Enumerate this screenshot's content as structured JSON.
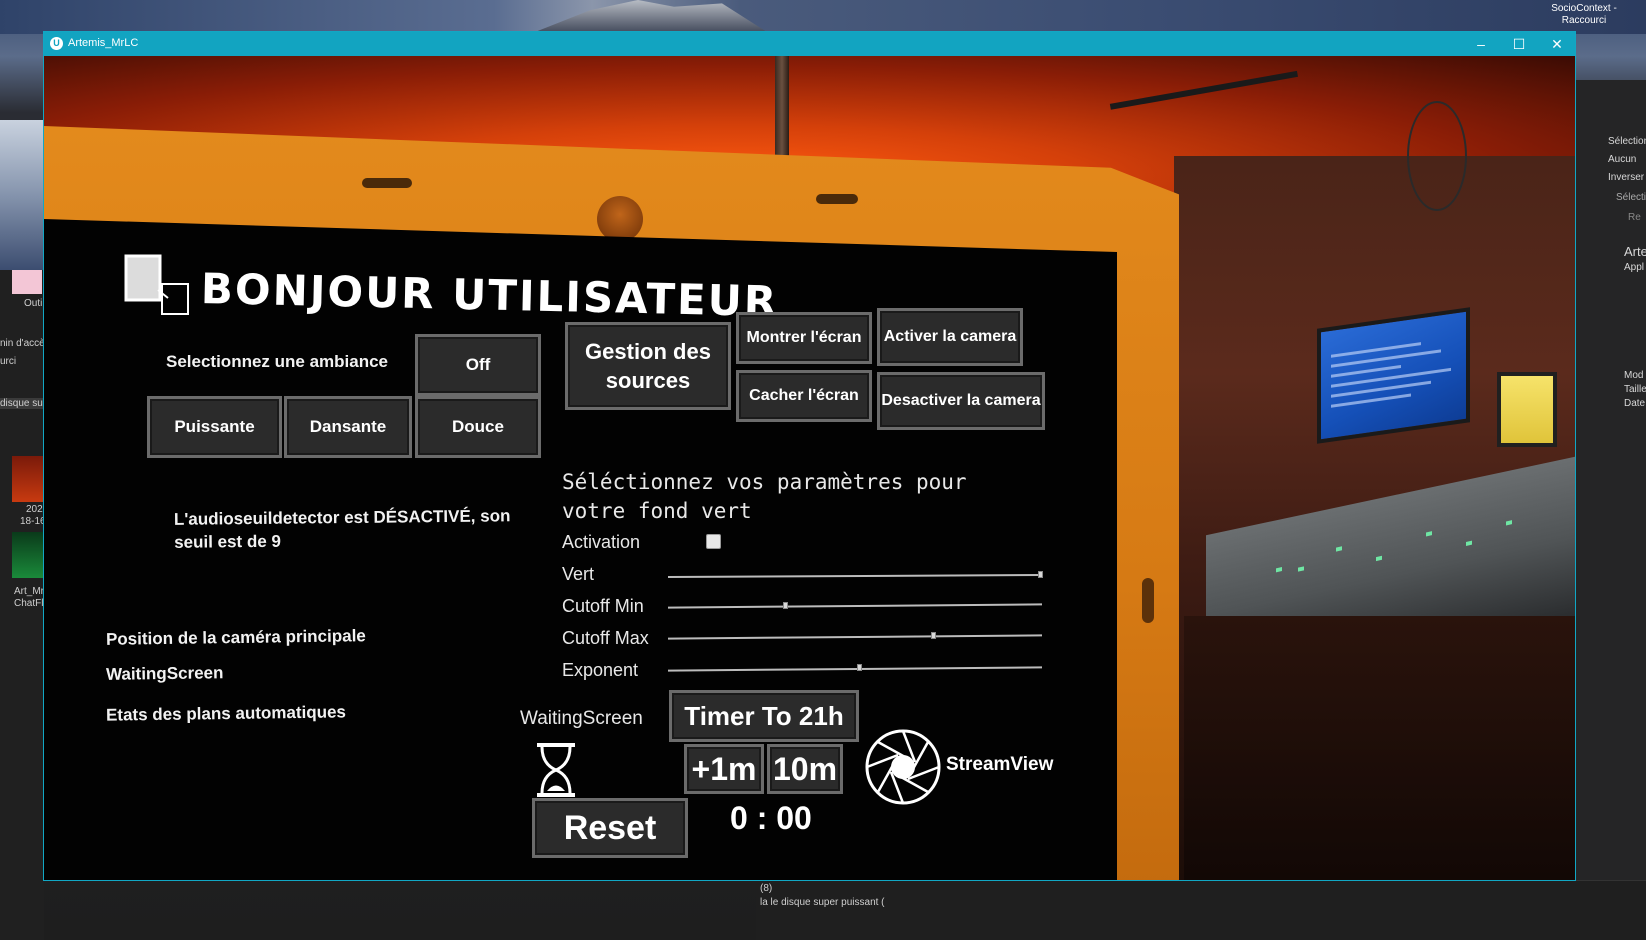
{
  "desktop": {
    "tray_text_1": "SocioContext -",
    "tray_text_2": "Raccourci",
    "left_labels": [
      "Outi",
      "nin d'accès",
      "urci",
      "disque su",
      "202",
      "18-16",
      "Art_Mr",
      "ChatFl"
    ],
    "right_labels": [
      "Sélection",
      "Aucun",
      "Inverser l",
      "Sélectio",
      "Re",
      "Arte",
      "Appl",
      "Mod",
      "Taille",
      "Date"
    ],
    "bottom_texts": [
      "la le disque super puissant (",
      "(8)"
    ]
  },
  "window": {
    "title": "Artemis_MrLC",
    "controls": {
      "minimize": "–",
      "maximize": "☐",
      "close": "✕"
    }
  },
  "screen": {
    "heading": "BONJOUR UTILISATEUR",
    "ambiance_label": "Selectionnez une ambiance",
    "ambiance_buttons": {
      "off": "Off",
      "puissante": "Puissante",
      "dansante": "Dansante",
      "douce": "Douce"
    },
    "audio_status": "L'audioseuildetector est DÉSACTIVÉ, son seuil est de 9",
    "status_lines": [
      "Position de la caméra principale",
      "WaitingScreen",
      "Etats des plans automatiques"
    ],
    "source_buttons": {
      "gestion": "Gestion des sources",
      "montrer": "Montrer l'écran",
      "cacher": "Cacher l'écran",
      "activer_cam": "Activer la camera",
      "desactiver_cam": "Desactiver la camera"
    },
    "green_screen": {
      "title": "Séléctionnez vos paramètres pour votre fond vert",
      "activation_label": "Activation",
      "activation_checked": false,
      "params": [
        {
          "label": "Vert",
          "value": 1.0
        },
        {
          "label": "Cutoff Min",
          "value": 0.31
        },
        {
          "label": "Cutoff Max",
          "value": 0.71
        },
        {
          "label": "Exponent",
          "value": 0.51
        }
      ]
    },
    "waiting": {
      "label": "WaitingScreen",
      "timer_button": "Timer To 21h",
      "plus1_button": "+1m",
      "ten_button": "10m",
      "reset_button": "Reset",
      "time": "0 : 00"
    },
    "streamview_label": "StreamView"
  },
  "colors": {
    "titlebar": "#12a4c1",
    "tablet_orange": "#e38a1c",
    "button_bg": "#2b2b2b",
    "button_border": "#6b6b6b"
  }
}
